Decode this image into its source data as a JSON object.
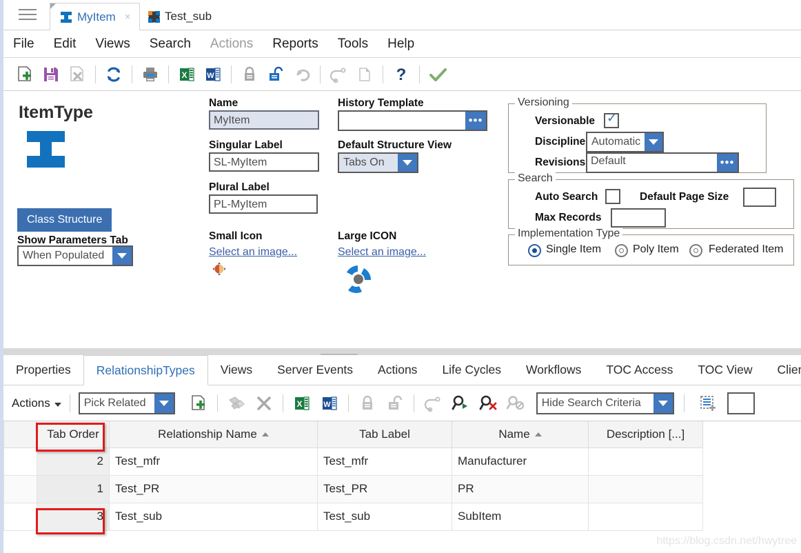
{
  "window": {
    "tabs": [
      {
        "label": "MyItem",
        "icon": "ibeam-icon",
        "active": true,
        "close": "×"
      },
      {
        "label": "Test_sub",
        "icon": "quad-plus-icon",
        "active": false
      }
    ]
  },
  "menubar": {
    "items": [
      {
        "label": "File",
        "disabled": false
      },
      {
        "label": "Edit",
        "disabled": false
      },
      {
        "label": "Views",
        "disabled": false
      },
      {
        "label": "Search",
        "disabled": false
      },
      {
        "label": "Actions",
        "disabled": true
      },
      {
        "label": "Reports",
        "disabled": false
      },
      {
        "label": "Tools",
        "disabled": false
      },
      {
        "label": "Help",
        "disabled": false
      }
    ]
  },
  "toolbar": {
    "buttons": [
      "new-icon",
      "save-icon",
      "delete-icon",
      "refresh-icon",
      "print-icon",
      "export-excel-icon",
      "export-word-icon",
      "lock-icon",
      "unlock-icon",
      "undo-icon",
      "redo-icon",
      "copy-icon",
      "help-icon",
      "done-icon"
    ]
  },
  "form": {
    "type_title": "ItemType",
    "class_structure_button": "Class Structure",
    "show_parameters_tab_label": "Show Parameters Tab",
    "show_parameters_tab_value": "When Populated",
    "name_label": "Name",
    "name_value": "MyItem",
    "singular_label": "Singular Label",
    "singular_value": "SL-MyItem",
    "plural_label": "Plural Label",
    "plural_value": "PL-MyItem",
    "small_icon_label": "Small Icon",
    "small_icon_link": "Select an image...",
    "large_icon_label": "Large ICON",
    "large_icon_link": "Select an image...",
    "history_template_label": "History Template",
    "history_template_value": "",
    "default_structure_view_label": "Default Structure View",
    "default_structure_view_value": "Tabs On",
    "ellipsis_label": "•••"
  },
  "versioning": {
    "title": "Versioning",
    "versionable_label": "Versionable",
    "versionable_checked": true,
    "discipline_label": "Discipline",
    "discipline_value": "Automatic",
    "revisions_label": "Revisions",
    "revisions_value": "Default"
  },
  "search_group": {
    "title": "Search",
    "auto_search_label": "Auto Search",
    "auto_search_checked": false,
    "default_page_size_label": "Default Page Size",
    "default_page_size_value": "",
    "max_records_label": "Max Records",
    "max_records_value": ""
  },
  "implementation": {
    "title": "Implementation Type",
    "options": [
      {
        "label": "Single Item",
        "selected": true
      },
      {
        "label": "Poly Item",
        "selected": false
      },
      {
        "label": "Federated Item",
        "selected": false
      }
    ]
  },
  "bottom_tabs": [
    {
      "label": "Properties",
      "active": false
    },
    {
      "label": "RelationshipTypes",
      "active": true
    },
    {
      "label": "Views",
      "active": false
    },
    {
      "label": "Server Events",
      "active": false
    },
    {
      "label": "Actions",
      "active": false
    },
    {
      "label": "Life Cycles",
      "active": false
    },
    {
      "label": "Workflows",
      "active": false
    },
    {
      "label": "TOC Access",
      "active": false
    },
    {
      "label": "TOC View",
      "active": false
    },
    {
      "label": "Client",
      "active": false
    }
  ],
  "bottom_toolbar": {
    "actions_label": "Actions",
    "pick_related_value": "Pick Related",
    "hide_search_criteria_value": "Hide Search Criteria",
    "search_box_value": "",
    "buttons": [
      "new-relationship-icon",
      "pick-existing-icon",
      "delete-relationship-icon",
      "export-excel-icon",
      "export-word-icon",
      "lock-icon",
      "unlock-icon",
      "redo-icon",
      "run-search-icon",
      "clear-search-icon",
      "disabled-search-icon",
      "select-all-icon"
    ]
  },
  "grid": {
    "columns": [
      {
        "label": "",
        "sorted": ""
      },
      {
        "label": "Tab Order",
        "sorted": ""
      },
      {
        "label": "Relationship Name",
        "sorted": "asc"
      },
      {
        "label": "Tab Label",
        "sorted": ""
      },
      {
        "label": "Name",
        "sorted": "asc"
      },
      {
        "label": "Description [...]",
        "sorted": ""
      }
    ],
    "rows": [
      {
        "tab_order": "2",
        "relationship_name": "Test_mfr",
        "tab_label": "Test_mfr",
        "name": "Manufacturer",
        "description": ""
      },
      {
        "tab_order": "1",
        "relationship_name": "Test_PR",
        "tab_label": "Test_PR",
        "name": "PR",
        "description": ""
      },
      {
        "tab_order": "3",
        "relationship_name": "Test_sub",
        "tab_label": "Test_sub",
        "name": "SubItem",
        "description": ""
      }
    ]
  },
  "watermark": "https://blog.csdn.net/hwytree",
  "colors": {
    "accent_blue": "#1272bd",
    "button_blue": "#3b6fb0",
    "combo_blue": "#4178be",
    "highlight_field": "#dde2ef",
    "annotation_red": "#e01b1b",
    "orange": "#e8862b"
  }
}
